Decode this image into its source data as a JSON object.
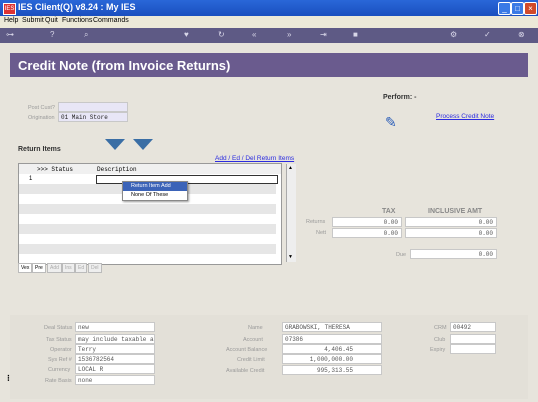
{
  "window": {
    "title": "IES Client(Q) v8.24 : My IES"
  },
  "menu": [
    "Help",
    "Submit",
    "Quit",
    "Functions",
    "Commands"
  ],
  "header": {
    "title": "Credit Note (from Invoice Returns)"
  },
  "form": {
    "post_cust_label": "Post Cust?",
    "post_cust_value": "",
    "origination_label": "Origination",
    "origination_value": "01 Main Store",
    "perform_label": "Perform: -",
    "process_link": "Process Credit Note"
  },
  "return_items": {
    "title": "Return Items",
    "add_link": "Add / Ed / Del Return Items",
    "columns": [
      ">>> Status",
      "Description"
    ],
    "first_row_num": "1",
    "context_menu": [
      "Return Item Add",
      "None Of These"
    ],
    "tabs": [
      "Vex",
      "Pre",
      "Add",
      "Ins",
      "Ed",
      "Del"
    ]
  },
  "totals": {
    "tax_header": "TAX",
    "incl_header": "INCLUSIVE AMT",
    "returns_label": "Returns",
    "nett_label": "Nett",
    "due_label": "Due",
    "returns_tax": "0.00",
    "returns_amt": "0.00",
    "nett_tax": "0.00",
    "nett_amt": "0.00",
    "due_amt": "0.00"
  },
  "deal": {
    "deal_status_label": "Deal Status",
    "deal_status": "new",
    "tax_status_label": "Tax Status",
    "tax_status": "may include taxable a",
    "operator_label": "Operator",
    "operator": "Terry",
    "sys_ref_label": "Sys Ref #",
    "sys_ref": "1536782564",
    "currency_label": "Currency",
    "currency": "LOCAL R",
    "rate_basis_label": "Rate Basis",
    "rate_basis": "none"
  },
  "account": {
    "name_label": "Name",
    "name": "GRABOWSKI, THERESA",
    "account_label": "Account",
    "account": "07386",
    "balance_label": "Account Balance",
    "balance": "4,406.45",
    "credit_limit_label": "Credit Limit",
    "credit_limit": "1,000,000.00",
    "available_label": "Available Credit",
    "available": "995,313.55"
  },
  "crm": {
    "crm_label": "CRM",
    "crm": "00492",
    "club_label": "Club",
    "club": "",
    "expiry_label": "Expiry",
    "expiry": ""
  }
}
